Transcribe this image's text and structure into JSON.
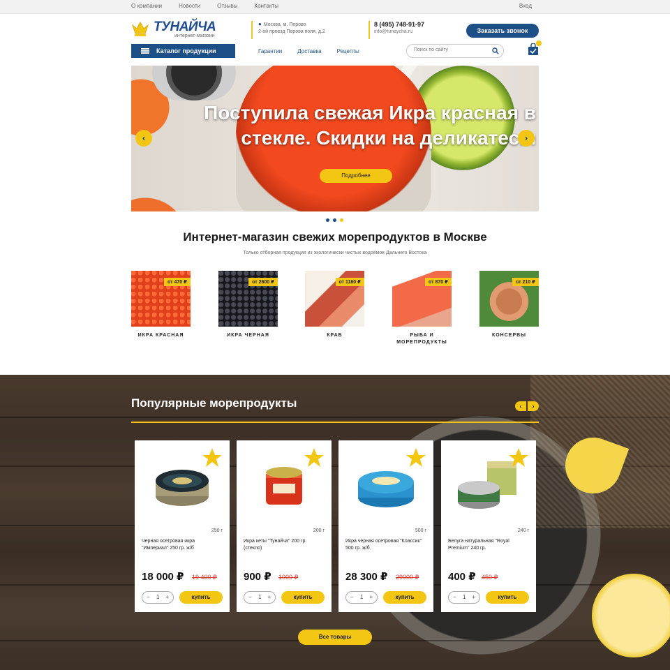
{
  "topbar": {
    "links": [
      "О компании",
      "Новости",
      "Отзывы",
      "Контакты"
    ],
    "login": "Вход"
  },
  "header": {
    "brand": "ТУНАЙЧА",
    "brand_sub": "интернет-магазин",
    "address_line1": "Москва, м. Перово",
    "address_line2": "2-ой проезд Перова поля, д.2",
    "phone": "8 (495) 748-91-97",
    "email": "info@tunaycha.ru",
    "callback": "Заказать звонок"
  },
  "nav": {
    "catalog": "Каталог продукции",
    "links": [
      "Гарантии",
      "Доставка",
      "Рецепты"
    ],
    "search_placeholder": "Поиск по сайту"
  },
  "hero": {
    "headline": "Поступила свежая Икра красная в стекле. Скидки на деликатесы",
    "more": "Подробнее"
  },
  "intro": {
    "title": "Интернет-магазин свежих морепродуктов в Москве",
    "subtitle": "Только отборная продукция из экологически чистых водоёмов Дальнего Востока"
  },
  "categories": [
    {
      "label": "ИКРА КРАСНАЯ",
      "price": "от 470 ₽"
    },
    {
      "label": "ИКРА ЧЕРНАЯ",
      "price": "от 2600 ₽"
    },
    {
      "label": "КРАБ",
      "price": "от 1160 ₽"
    },
    {
      "label": "РЫБА И МОРЕПРОДУКТЫ",
      "price": "от 870 ₽"
    },
    {
      "label": "КОНСЕРВЫ",
      "price": "от 210 ₽"
    }
  ],
  "popular": {
    "title": "Популярные морепродукты",
    "all": "Все товары",
    "qty_default": "1",
    "buy": "купить",
    "products": [
      {
        "weight": "250 г",
        "name": "Черная осетровая икра \"Империал\" 250 гр. ж/б",
        "price": "18 000 ₽",
        "old": "19 400 ₽"
      },
      {
        "weight": "200 г",
        "name": "Икра кеты \"Тунайча\" 200 гр. (стекло)",
        "price": "900 ₽",
        "old": "1000 ₽"
      },
      {
        "weight": "500 г",
        "name": "Икра черная осетровая \"Классик\" 500 гр. ж/б",
        "price": "28 300 ₽",
        "old": "29000 ₽"
      },
      {
        "weight": "240 г",
        "name": "Белуга натуральная \"Royal Premium\" 240 гр.",
        "price": "400 ₽",
        "old": "450 ₽"
      }
    ]
  },
  "colors": {
    "brand_blue": "#1d4f87",
    "accent_yellow": "#f3c614",
    "old_price_red": "#d23b2e"
  }
}
